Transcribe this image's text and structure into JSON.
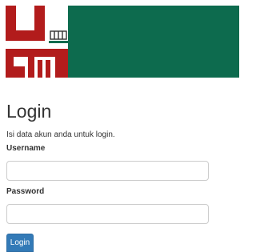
{
  "colors": {
    "banner": "#0d6b4e",
    "logo_red": "#b21c1c",
    "button": "#337ab7"
  },
  "header": {
    "logo_icon": "university-logo-icon"
  },
  "login": {
    "title": "Login",
    "subtitle": "Isi data akun anda untuk login.",
    "username_label": "Username",
    "username_value": "",
    "password_label": "Password",
    "password_value": "",
    "submit_label": "Login"
  }
}
